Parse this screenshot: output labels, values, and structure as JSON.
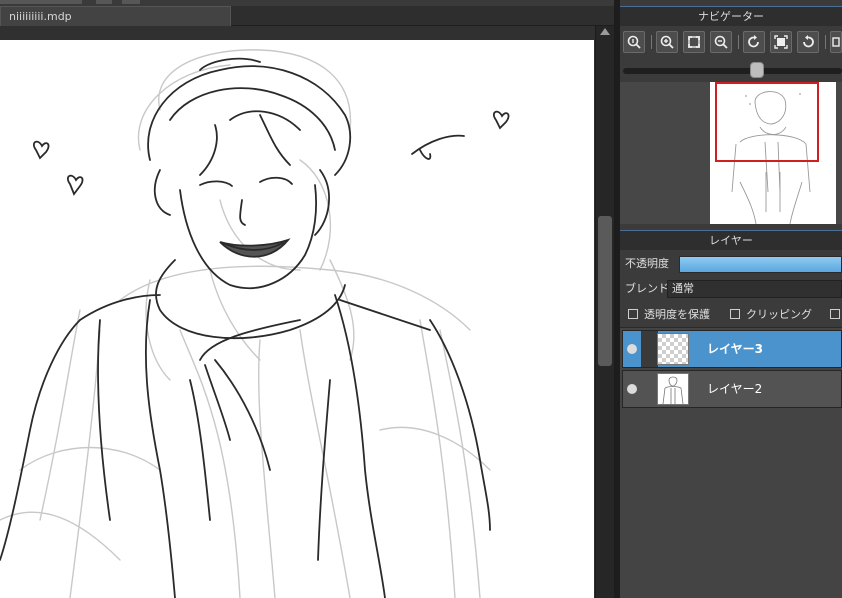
{
  "document": {
    "file_tab": "niiiiiiiii.mdp"
  },
  "navigator": {
    "title": "ナビゲーター",
    "tools": [
      "zoom-actual-icon",
      "zoom-in-icon",
      "fit-screen-icon",
      "zoom-out-icon",
      "rotate-left-icon",
      "fullscreen-icon",
      "rotate-right-icon",
      "flip-icon"
    ],
    "zoom_level": 0.62
  },
  "layers": {
    "title": "レイヤー",
    "opacity_label": "不透明度",
    "opacity_value": 1.0,
    "blend_label": "ブレンド",
    "blend_value": "通常",
    "protect_alpha_label": "透明度を保護",
    "clipping_label": "クリッピング",
    "items": [
      {
        "name": "レイヤー3",
        "selected": true
      },
      {
        "name": "レイヤー2",
        "selected": false
      }
    ]
  },
  "colors": {
    "accent": "#4a93cc",
    "opacity_fill": "#6fb7e8",
    "nav_frame": "#d01f1f"
  }
}
